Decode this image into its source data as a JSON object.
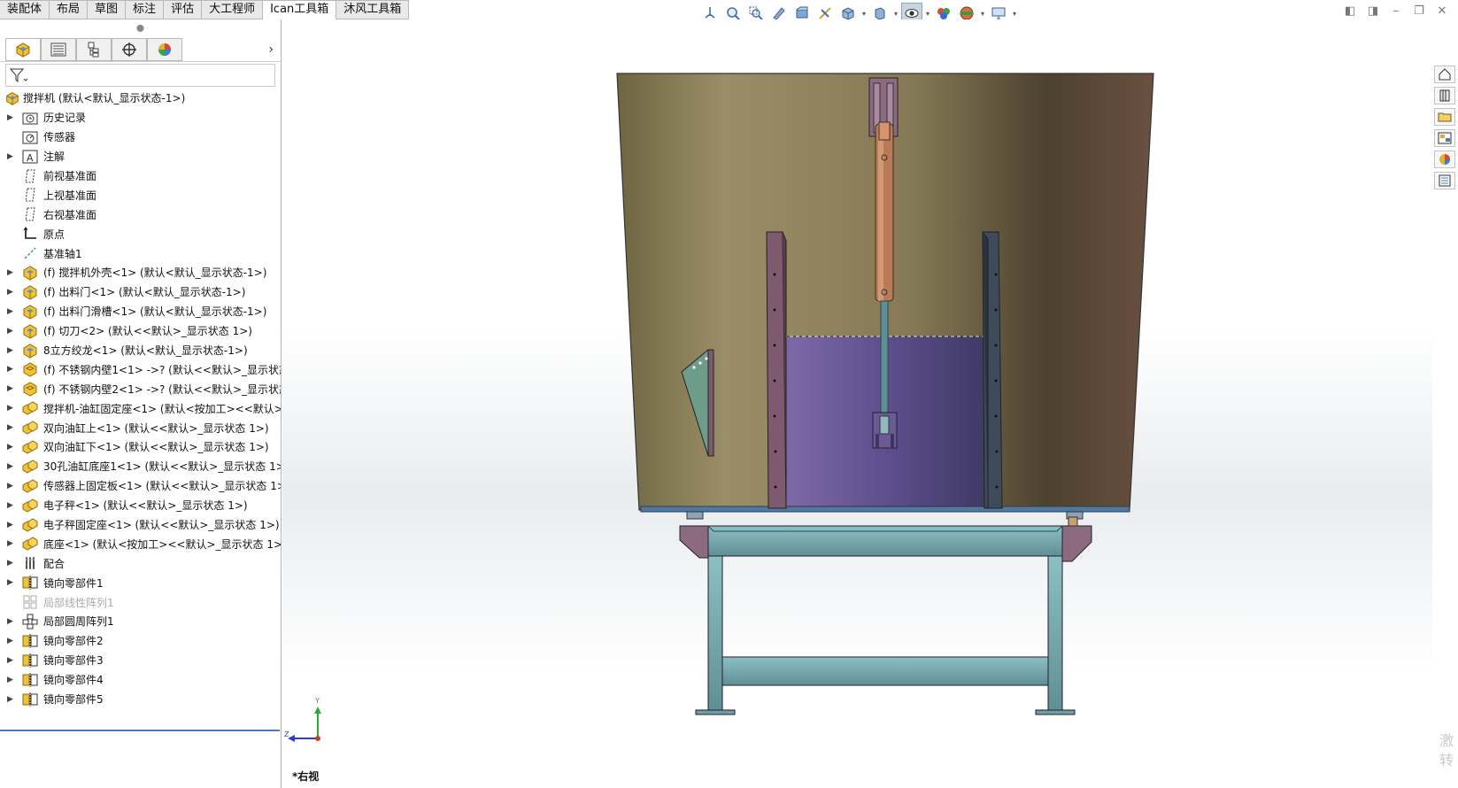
{
  "command_tabs": [
    "装配体",
    "布局",
    "草图",
    "标注",
    "评估",
    "大工程师",
    "Ican工具箱",
    "沐风工具箱"
  ],
  "active_tab_index": 6,
  "view_toolbar": {
    "icons": [
      "view-orientation-icon",
      "zoom-to-fit-icon",
      "zoom-to-area-icon",
      "previous-view-icon",
      "section-view-icon",
      "dynamic-annotation-icon",
      "view-orientation-cube-icon",
      "display-style-icon",
      "hide-show-items-icon",
      "edit-appearance-icon",
      "apply-scene-icon",
      "view-settings-icon"
    ]
  },
  "feature_tree": {
    "root": "搅拌机 (默认<默认_显示状态-1>)",
    "items": [
      {
        "label": "历史记录",
        "icon": "history-folder-icon",
        "expandable": true,
        "dim": false
      },
      {
        "label": "传感器",
        "icon": "sensor-icon",
        "expandable": false,
        "dim": false
      },
      {
        "label": "注解",
        "icon": "annotation-icon",
        "expandable": true,
        "dim": false
      },
      {
        "label": "前视基准面",
        "icon": "plane-icon",
        "expandable": false,
        "dim": false
      },
      {
        "label": "上视基准面",
        "icon": "plane-icon",
        "expandable": false,
        "dim": false
      },
      {
        "label": "右视基准面",
        "icon": "plane-icon",
        "expandable": false,
        "dim": false
      },
      {
        "label": "原点",
        "icon": "origin-icon",
        "expandable": false,
        "dim": false
      },
      {
        "label": "基准轴1",
        "icon": "axis-icon",
        "expandable": false,
        "dim": false
      },
      {
        "label": "(f) 搅拌机外壳<1> (默认<默认_显示状态-1>)",
        "icon": "part-icon",
        "expandable": true,
        "dim": false
      },
      {
        "label": "(f) 出料门<1> (默认<默认_显示状态-1>)",
        "icon": "part-icon",
        "expandable": true,
        "dim": false
      },
      {
        "label": "(f) 出料门滑槽<1> (默认<默认_显示状态-1>)",
        "icon": "part-icon",
        "expandable": true,
        "dim": false
      },
      {
        "label": "(f) 切刀<2> (默认<<默认>_显示状态 1>)",
        "icon": "part-icon",
        "expandable": true,
        "dim": false
      },
      {
        "label": "8立方绞龙<1> (默认<默认_显示状态-1>)",
        "icon": "part-icon",
        "expandable": true,
        "dim": false
      },
      {
        "label": "(f) 不锈钢内壁1<1> ->? (默认<<默认>_显示状态",
        "icon": "part-warning-icon",
        "expandable": true,
        "dim": false
      },
      {
        "label": "(f) 不锈钢内壁2<1> ->? (默认<<默认>_显示状态",
        "icon": "part-warning-icon",
        "expandable": true,
        "dim": false
      },
      {
        "label": "搅拌机-油缸固定座<1> (默认<按加工><<默认>_",
        "icon": "assembly-icon",
        "expandable": true,
        "dim": false
      },
      {
        "label": "双向油缸上<1> (默认<<默认>_显示状态 1>)",
        "icon": "assembly-icon",
        "expandable": true,
        "dim": false
      },
      {
        "label": "双向油缸下<1> (默认<<默认>_显示状态 1>)",
        "icon": "assembly-icon",
        "expandable": true,
        "dim": false
      },
      {
        "label": "30孔油缸底座1<1> (默认<<默认>_显示状态 1>)",
        "icon": "assembly-icon",
        "expandable": true,
        "dim": false
      },
      {
        "label": "传感器上固定板<1> (默认<<默认>_显示状态 1>)",
        "icon": "assembly-icon",
        "expandable": true,
        "dim": false
      },
      {
        "label": "电子秤<1> (默认<<默认>_显示状态 1>)",
        "icon": "assembly-icon",
        "expandable": true,
        "dim": false
      },
      {
        "label": "电子秤固定座<1> (默认<<默认>_显示状态 1>)",
        "icon": "assembly-icon",
        "expandable": true,
        "dim": false
      },
      {
        "label": "底座<1> (默认<按加工><<默认>_显示状态 1>)",
        "icon": "assembly-icon",
        "expandable": true,
        "dim": false
      },
      {
        "label": "配合",
        "icon": "mates-icon",
        "expandable": true,
        "dim": false
      },
      {
        "label": "镜向零部件1",
        "icon": "mirror-component-icon",
        "expandable": true,
        "dim": false
      },
      {
        "label": "局部线性阵列1",
        "icon": "linear-pattern-icon",
        "expandable": false,
        "dim": true
      },
      {
        "label": "局部圆周阵列1",
        "icon": "circular-pattern-icon",
        "expandable": true,
        "dim": false
      },
      {
        "label": "镜向零部件2",
        "icon": "mirror-component-icon",
        "expandable": true,
        "dim": false
      },
      {
        "label": "镜向零部件3",
        "icon": "mirror-component-icon",
        "expandable": true,
        "dim": false
      },
      {
        "label": "镜向零部件4",
        "icon": "mirror-component-icon",
        "expandable": true,
        "dim": false
      },
      {
        "label": "镜向零部件5",
        "icon": "mirror-component-icon",
        "expandable": true,
        "dim": false
      }
    ]
  },
  "view_name": "*右视",
  "triad": {
    "y": "Y",
    "z": "Z"
  },
  "watermark": [
    "激",
    "转"
  ],
  "colors": {
    "shell": "#8c7f58",
    "inner": "#6a5a96",
    "frame": "#6f9ea6",
    "cylinder": "#b97a55",
    "bracket": "#8c6a80",
    "accent": "#4a7ab2"
  }
}
